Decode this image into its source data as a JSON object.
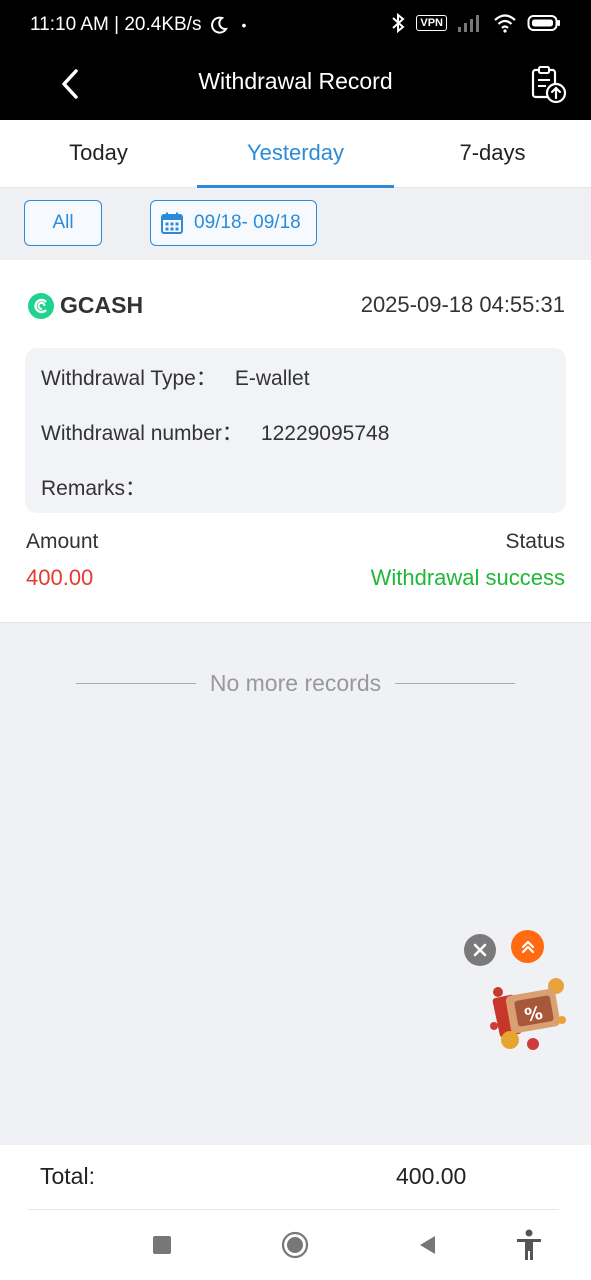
{
  "status_bar": {
    "time_speed": "11:10 AM | 20.4KB/s",
    "dot": "•",
    "vpn_label": "VPN",
    "icons": [
      "moon-icon",
      "bluetooth-icon",
      "vpn-badge",
      "signal-icon",
      "wifi-icon",
      "battery-icon"
    ]
  },
  "header": {
    "title": "Withdrawal Record",
    "back_icon": "chevron-left-icon",
    "action_icon": "clipboard-upload-icon"
  },
  "tabs": [
    {
      "label": "Today",
      "active": false
    },
    {
      "label": "Yesterday",
      "active": true
    },
    {
      "label": "7-days",
      "active": false
    }
  ],
  "filters": {
    "all_label": "All",
    "date_range": "09/18- 09/18"
  },
  "record": {
    "brand": "GCASH",
    "datetime": "2025-09-18 04:55:31",
    "type_label": "Withdrawal Type：",
    "type_value": "E-wallet",
    "number_label": "Withdrawal number：",
    "number_value": "12229095748",
    "remarks_label": "Remarks：",
    "remarks_value": "",
    "amount_label": "Amount",
    "amount_value": "400.00",
    "status_label": "Status",
    "status_value": "Withdrawal success"
  },
  "list_end": "No more records",
  "summary": {
    "total_label": "Total:",
    "total_value": "400.00"
  },
  "colors": {
    "accent": "#2b8bd8",
    "amount": "#e23c2e",
    "success": "#1fb838",
    "brand_logo": "#1fd38e",
    "fab_up": "#ff6a12"
  }
}
